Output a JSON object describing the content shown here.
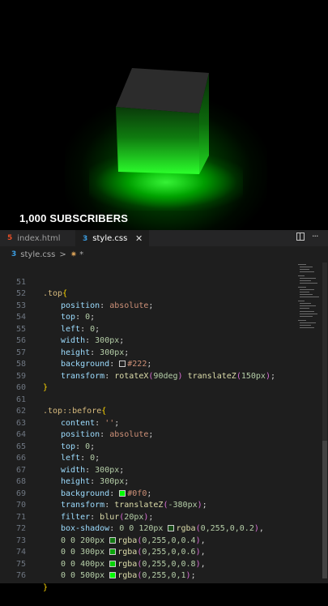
{
  "preview": {
    "banner": "1,000 SUBSCRIBERS"
  },
  "tabs": [
    {
      "label": "index.html",
      "icon": "html5-icon",
      "active": false
    },
    {
      "label": "style.css",
      "icon": "css3-icon",
      "active": true
    }
  ],
  "tab_close": "✕",
  "breadcrumb": {
    "file": "style.css",
    "separator": ">",
    "symbol": "*"
  },
  "colors": {
    "accent_green": "#00ff00",
    "editor_bg": "#1e1e1e",
    "top_face": "#222222"
  },
  "code_lines": [
    {
      "n": "51",
      "t": ".top{"
    },
    {
      "n": "52",
      "t": "position: absolute;"
    },
    {
      "n": "53",
      "t": "top: 0;"
    },
    {
      "n": "54",
      "t": "left: 0;"
    },
    {
      "n": "55",
      "t": "width: 300px;"
    },
    {
      "n": "56",
      "t": "height: 300px;"
    },
    {
      "n": "57",
      "t": "background: #222;"
    },
    {
      "n": "58",
      "t": "transform: rotateX(90deg) translateZ(150px);"
    },
    {
      "n": "59",
      "t": "}"
    },
    {
      "n": "60",
      "t": ""
    },
    {
      "n": "61",
      "t": ".top::before{"
    },
    {
      "n": "62",
      "t": "content: '';"
    },
    {
      "n": "63",
      "t": "position: absolute;"
    },
    {
      "n": "64",
      "t": "top: 0;"
    },
    {
      "n": "65",
      "t": "left: 0;"
    },
    {
      "n": "66",
      "t": "width: 300px;"
    },
    {
      "n": "67",
      "t": "height: 300px;"
    },
    {
      "n": "68",
      "t": "background: #0f0;"
    },
    {
      "n": "69",
      "t": "transform: translateZ(-380px);"
    },
    {
      "n": "70",
      "t": "filter: blur(20px);"
    },
    {
      "n": "71",
      "t": "box-shadow: 0 0 120px rgba(0,255,0,0.2),"
    },
    {
      "n": "72",
      "t": "0 0 200px rgba(0,255,0,0.4),"
    },
    {
      "n": "73",
      "t": "0 0 300px rgba(0,255,0,0.6),"
    },
    {
      "n": "74",
      "t": "0 0 400px rgba(0,255,0,0.8),"
    },
    {
      "n": "75",
      "t": "0 0 500px rgba(0,255,0,1);"
    },
    {
      "n": "76",
      "t": "}"
    }
  ]
}
